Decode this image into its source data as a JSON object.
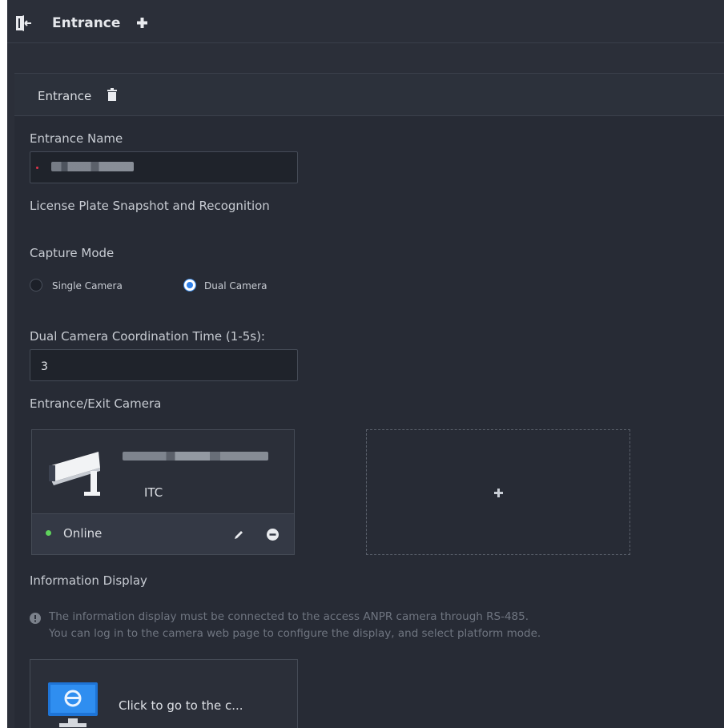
{
  "header": {
    "title": "Entrance",
    "icons": {
      "exit": "exit-door-icon",
      "add": "plus-icon"
    }
  },
  "panel": {
    "title": "Entrance",
    "delete_icon": "trash-icon"
  },
  "form": {
    "entrance_name_label": "Entrance Name",
    "lpr_section_label": "License Plate Snapshot and Recognition",
    "capture_mode_label": "Capture Mode",
    "capture_modes": [
      {
        "label": "Single Camera",
        "selected": false
      },
      {
        "label": "Dual Camera",
        "selected": true
      }
    ],
    "coordination_label": "Dual Camera Coordination Time (1-5s):",
    "coordination_value": "3",
    "camera_section_label": "Entrance/Exit Camera"
  },
  "camera_card": {
    "type": "ITC",
    "status": "Online",
    "status_color": "#5fd35c"
  },
  "info_display": {
    "label": "Information Display",
    "note_line1": "The information display must be connected to the access ANPR camera through RS-485.",
    "note_line2": "You can log in to the camera web page to configure the display, and select platform mode.",
    "link_text": "Click to go to the c..."
  },
  "colors": {
    "background": "#2b2f39",
    "accent": "#2f80e8",
    "required": "#e0344b"
  }
}
